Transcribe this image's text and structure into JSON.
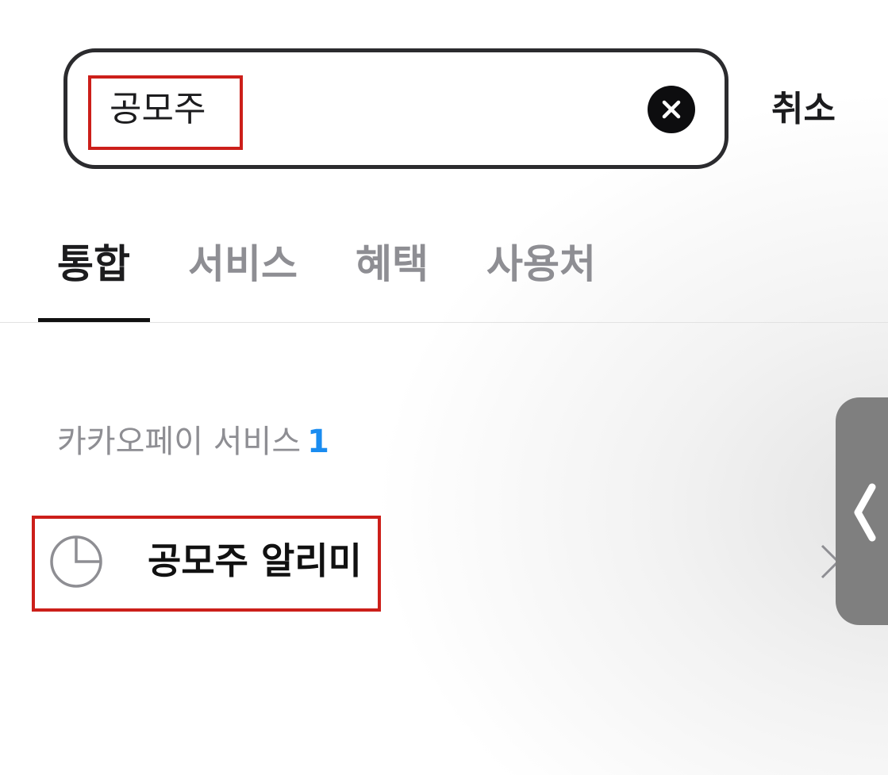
{
  "search": {
    "query": "공모주",
    "clear_icon": "close-circle-icon",
    "cancel_label": "취소"
  },
  "tabs": [
    {
      "label": "통합",
      "active": true
    },
    {
      "label": "서비스",
      "active": false
    },
    {
      "label": "혜택",
      "active": false
    },
    {
      "label": "사용처",
      "active": false
    }
  ],
  "section": {
    "title": "카카오페이 서비스",
    "count": "1"
  },
  "results": [
    {
      "label": "공모주 알리미",
      "icon": "pie-chart-icon"
    }
  ],
  "side_handle": {
    "icon": "chevron-left-icon"
  },
  "colors": {
    "accent_blue": "#1a8cf0",
    "highlight_red": "#cc1f1a",
    "text_primary": "#1c1c1e",
    "text_secondary": "#8e8e93"
  }
}
